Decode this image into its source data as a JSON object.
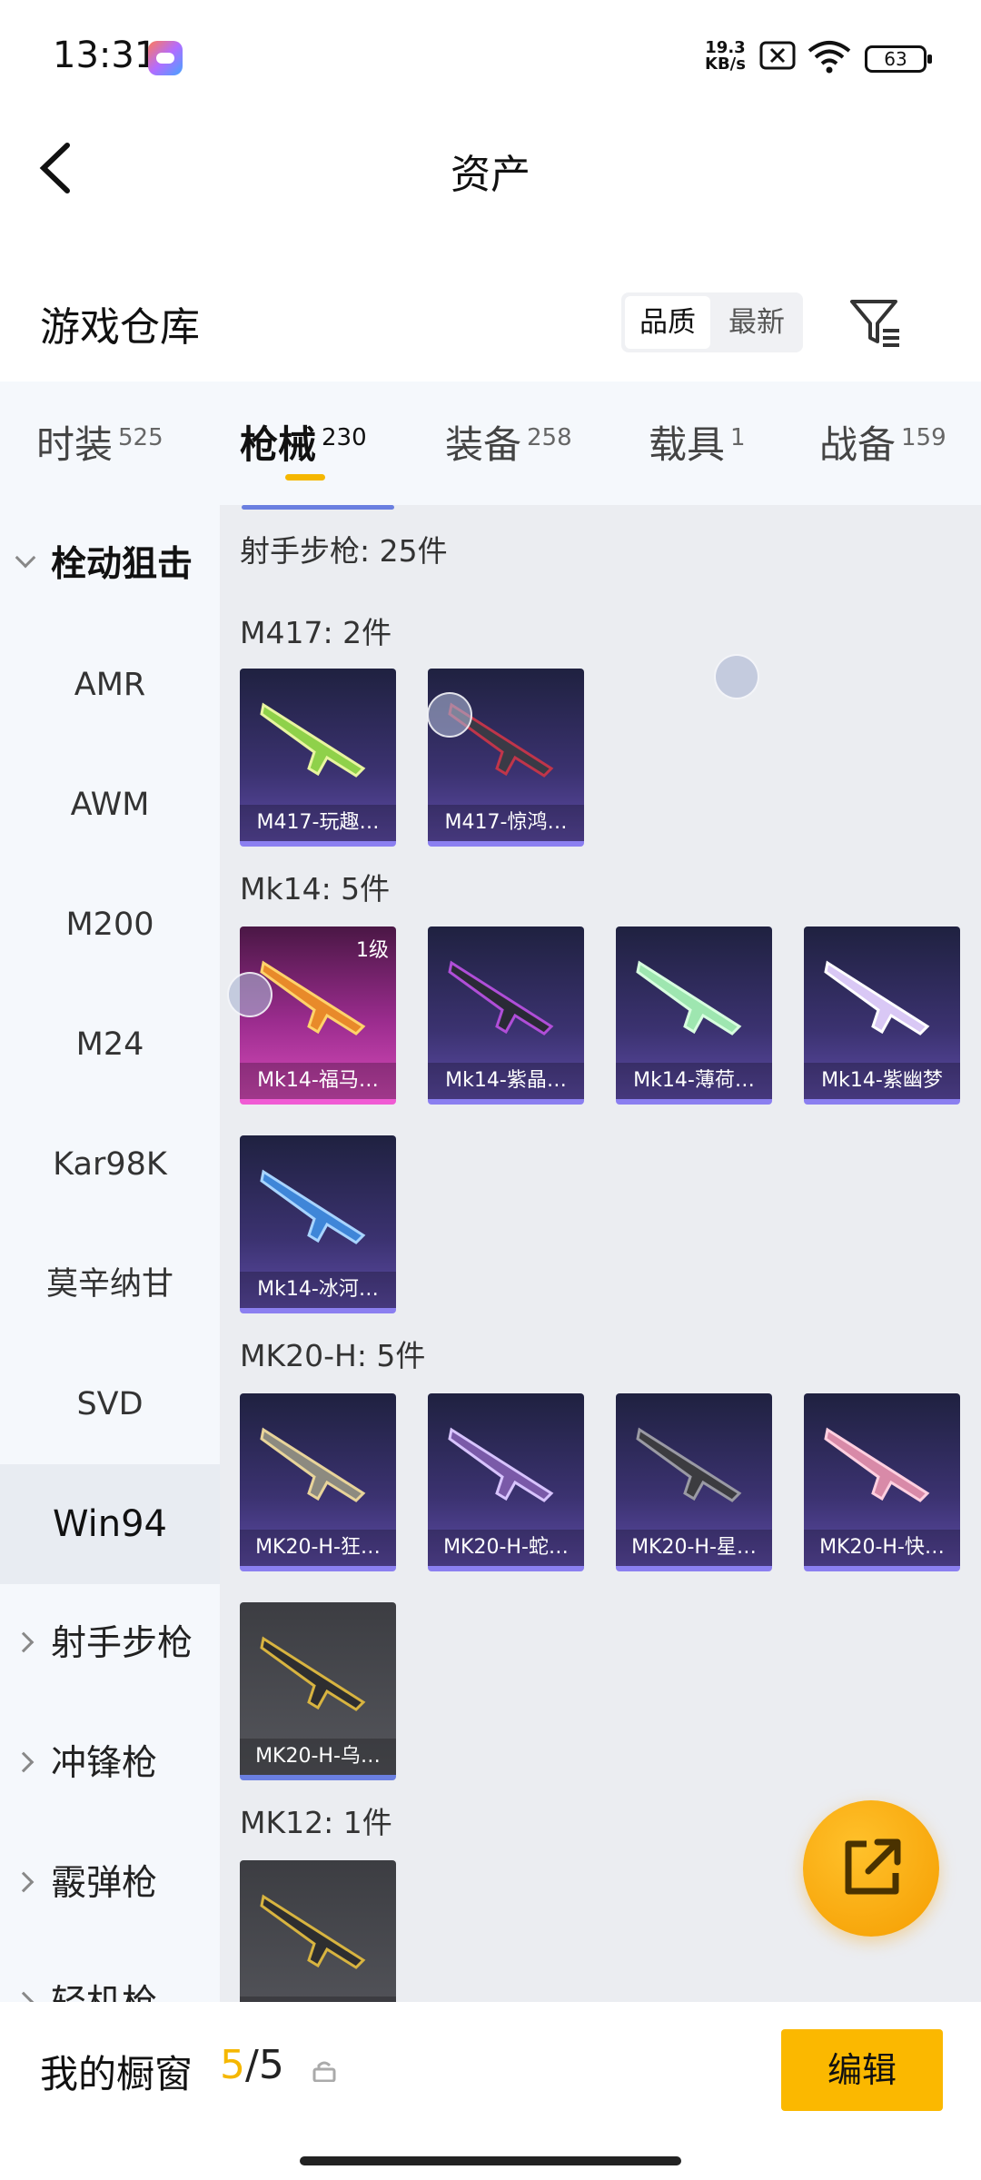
{
  "status_bar": {
    "time": "13:31",
    "net_speed_value": "19.3",
    "net_speed_unit": "KB/s",
    "battery": "63",
    "icons": [
      "game-center-icon",
      "sim-x-icon",
      "wifi-icon",
      "battery-icon"
    ]
  },
  "nav": {
    "title": "资产",
    "back_icon": "chevron-left-icon"
  },
  "warehouse": {
    "title": "游戏仓库",
    "sort": {
      "active": "品质",
      "inactive": "最新"
    },
    "filter_icon": "filter-icon"
  },
  "tabs": [
    {
      "label": "时装",
      "count": "525"
    },
    {
      "label": "枪械",
      "count": "230"
    },
    {
      "label": "装备",
      "count": "258"
    },
    {
      "label": "载具",
      "count": "1"
    },
    {
      "label": "战备",
      "count": "159"
    }
  ],
  "sidebar": {
    "items": [
      {
        "label": "栓动狙击"
      },
      {
        "label": "AMR"
      },
      {
        "label": "AWM"
      },
      {
        "label": "M200"
      },
      {
        "label": "M24"
      },
      {
        "label": "Kar98K"
      },
      {
        "label": "莫辛纳甘"
      },
      {
        "label": "SVD"
      },
      {
        "label": "Win94"
      },
      {
        "label": "射手步枪"
      },
      {
        "label": "冲锋枪"
      },
      {
        "label": "霰弹枪"
      },
      {
        "label": "轻机枪"
      }
    ]
  },
  "content": {
    "category_header": "射手步枪: 25件",
    "sections": [
      {
        "title": "M417: 2件",
        "items": [
          "M417-玩趣…",
          "M417-惊鸿…"
        ]
      },
      {
        "title": "Mk14: 5件",
        "items": [
          "Mk14-福马…",
          "Mk14-紫晶…",
          "Mk14-薄荷…",
          "Mk14-紫幽梦",
          "Mk14-冰河…"
        ],
        "badge": "1级"
      },
      {
        "title": "MK20-H: 5件",
        "items": [
          "MK20-H-狂…",
          "MK20-H-蛇…",
          "MK20-H-星…",
          "MK20-H-快…",
          "MK20-H-乌…"
        ]
      },
      {
        "title": "MK12: 1件",
        "items": [
          ""
        ]
      }
    ]
  },
  "fab": {
    "icon": "share-external-icon"
  },
  "bottom": {
    "title": "我的橱窗",
    "count_current": "5",
    "count_total": "/5",
    "lock_icon": "lock-icon",
    "edit_label": "编辑"
  },
  "colors": {
    "accent": "#fbb800",
    "tab_underline": "#f5b700",
    "card_border": "#8b7ff0",
    "pink_card": "#d64bb9"
  }
}
